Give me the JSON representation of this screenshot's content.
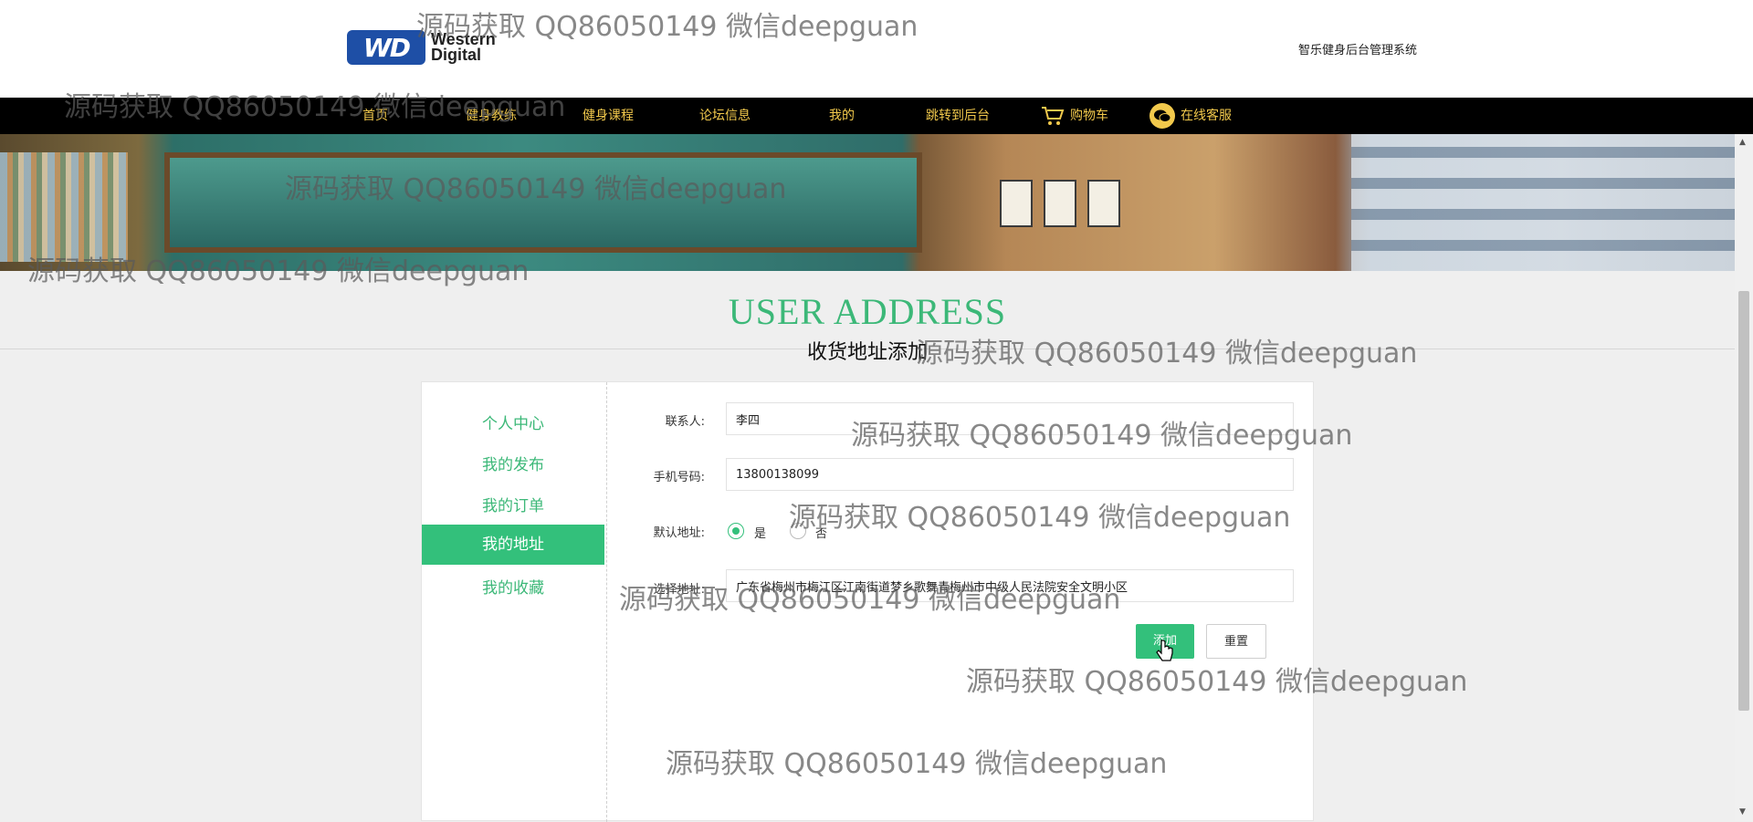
{
  "header": {
    "logo_mark": "WD",
    "logo_text_line1": "Western",
    "logo_text_line2": "Digital",
    "site_name": "智乐健身后台管理系统"
  },
  "nav": {
    "items": [
      {
        "label": "首页"
      },
      {
        "label": "健身教练"
      },
      {
        "label": "健身课程"
      },
      {
        "label": "论坛信息"
      },
      {
        "label": "我的"
      },
      {
        "label": "跳转到后台"
      },
      {
        "label": "购物车",
        "icon": "cart-icon"
      },
      {
        "label": "在线客服",
        "icon": "chat-icon"
      }
    ]
  },
  "section": {
    "title": "USER ADDRESS",
    "subtitle": "收货地址添加"
  },
  "sidebar": {
    "items": [
      {
        "label": "个人中心"
      },
      {
        "label": "我的发布"
      },
      {
        "label": "我的订单"
      },
      {
        "label": "我的地址",
        "active": true
      },
      {
        "label": "我的收藏"
      }
    ]
  },
  "form": {
    "contact_label": "联系人:",
    "contact_value": "李四",
    "phone_label": "手机号码:",
    "phone_value": "13800138099",
    "default_label": "默认地址:",
    "default_yes": "是",
    "default_no": "否",
    "default_selected": "是",
    "address_label": "选择地址:",
    "address_value": "广东省梅州市梅江区江南街道梦乡歌舞青梅州市中级人民法院安全文明小区",
    "submit_label": "添加",
    "reset_label": "重置"
  },
  "watermark": {
    "text": "源码获取 QQ86050149 微信deepguan"
  },
  "colors": {
    "accent": "#33c07b",
    "nav_bg": "#000000",
    "nav_text": "#f2c94c",
    "title_green": "#3cb878"
  }
}
